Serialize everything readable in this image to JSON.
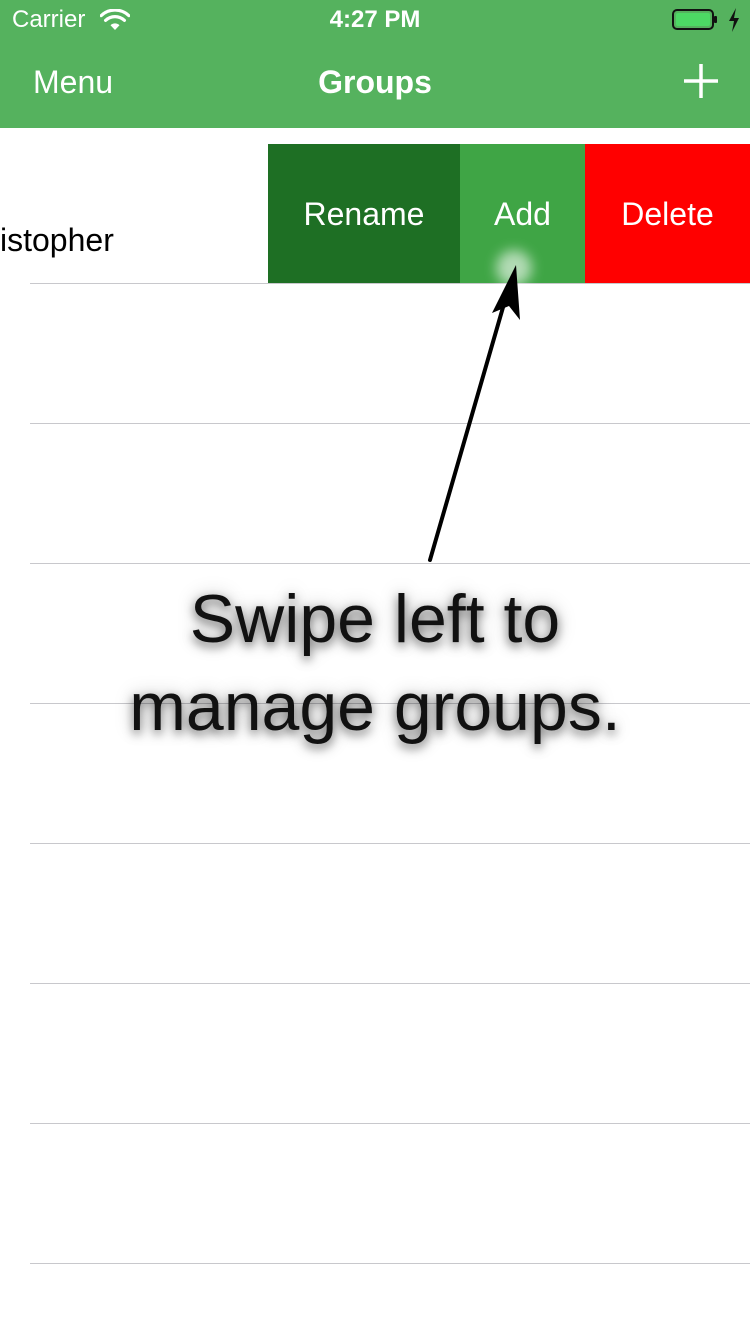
{
  "status_bar": {
    "carrier": "Carrier",
    "time": "4:27 PM",
    "battery_color": "#4cd964"
  },
  "nav": {
    "left_label": "Menu",
    "title": "Groups",
    "add_icon": "plus-icon",
    "bar_color": "#55b25e"
  },
  "rows": [
    {
      "label": "istopher"
    }
  ],
  "actions": [
    {
      "label": "Rename",
      "color": "#1e6f24"
    },
    {
      "label": "Add",
      "color": "#3fa545"
    },
    {
      "label": "Delete",
      "color": "#ff0000"
    }
  ],
  "callout": {
    "line1": "Swipe left to",
    "line2": "manage groups."
  }
}
